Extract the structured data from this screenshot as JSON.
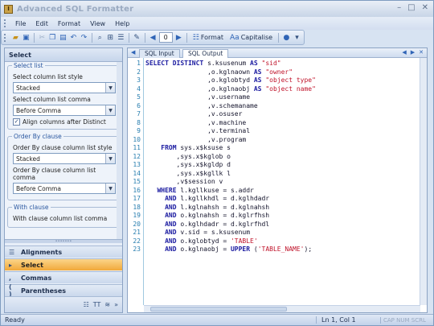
{
  "window": {
    "title": "Advanced SQL Formatter",
    "icon_letter": "I"
  },
  "menu": [
    "File",
    "Edit",
    "Format",
    "View",
    "Help"
  ],
  "toolbar": {
    "page_number": "0",
    "format_label": "Format",
    "capitalise_label": "Capitalise"
  },
  "left_panel": {
    "header": "Select",
    "select_list": {
      "title": "Select list",
      "style_label": "Select column list style",
      "style_value": "Stacked",
      "comma_label": "Select column list comma",
      "comma_value": "Before Comma",
      "align_label": "Align columns after Distinct"
    },
    "order_by": {
      "title": "Order By clause",
      "style_label": "Order By clause column list style",
      "style_value": "Stacked",
      "comma_label": "Order By clause column list comma",
      "comma_value": "Before Comma"
    },
    "with_clause": {
      "title": "With clause",
      "partial_label": "With clause column list comma"
    },
    "nav": [
      "Alignments",
      "Select",
      "Commas",
      "Parentheses"
    ]
  },
  "editor": {
    "tabs": [
      "SQL Input",
      "SQL Output"
    ],
    "active_tab": "SQL Output",
    "lines": [
      [
        [
          "kw",
          "SELECT DISTINCT"
        ],
        [
          "t",
          " s.ksusenum "
        ],
        [
          "kw",
          "AS"
        ],
        [
          "str",
          " \"sid\""
        ]
      ],
      [
        [
          "t",
          "                ,o.kglnaown "
        ],
        [
          "kw",
          "AS"
        ],
        [
          "str",
          " \"owner\""
        ]
      ],
      [
        [
          "t",
          "                ,o.kglobtyd "
        ],
        [
          "kw",
          "AS"
        ],
        [
          "str",
          " \"object type\""
        ]
      ],
      [
        [
          "t",
          "                ,o.kglnaobj "
        ],
        [
          "kw",
          "AS"
        ],
        [
          "str",
          " \"object name\""
        ]
      ],
      [
        [
          "t",
          "                ,v.username"
        ]
      ],
      [
        [
          "t",
          "                ,v.schemaname"
        ]
      ],
      [
        [
          "t",
          "                ,v.osuser"
        ]
      ],
      [
        [
          "t",
          "                ,v.machine"
        ]
      ],
      [
        [
          "t",
          "                ,v.terminal"
        ]
      ],
      [
        [
          "t",
          "                ,v.program"
        ]
      ],
      [
        [
          "kw",
          "    FROM"
        ],
        [
          "t",
          " sys.x$ksuse s"
        ]
      ],
      [
        [
          "t",
          "        ,sys.x$kglob o"
        ]
      ],
      [
        [
          "t",
          "        ,sys.x$kgldp d"
        ]
      ],
      [
        [
          "t",
          "        ,sys.x$kgllk l"
        ]
      ],
      [
        [
          "t",
          "        ,v$session v"
        ]
      ],
      [
        [
          "kw",
          "   WHERE"
        ],
        [
          "t",
          " l.kgllkuse = s.addr"
        ]
      ],
      [
        [
          "kw",
          "     AND"
        ],
        [
          "t",
          " l.kgllkhdl = d.kglhdadr"
        ]
      ],
      [
        [
          "kw",
          "     AND"
        ],
        [
          "t",
          " l.kglnahsh = d.kglnahsh"
        ]
      ],
      [
        [
          "kw",
          "     AND"
        ],
        [
          "t",
          " o.kglnahsh = d.kglrfhsh"
        ]
      ],
      [
        [
          "kw",
          "     AND"
        ],
        [
          "t",
          " o.kglhdadr = d.kglrfhdl"
        ]
      ],
      [
        [
          "kw",
          "     AND"
        ],
        [
          "t",
          " v.sid = s.ksusenum"
        ]
      ],
      [
        [
          "kw",
          "     AND"
        ],
        [
          "t",
          " o.kglobtyd = "
        ],
        [
          "str",
          "'TABLE'"
        ]
      ],
      [
        [
          "kw",
          "     AND"
        ],
        [
          "t",
          " o.kglnaobj = "
        ],
        [
          "kw",
          "UPPER"
        ],
        [
          "t",
          " ("
        ],
        [
          "str",
          "'TABLE_NAME'"
        ],
        [
          "t",
          ");"
        ]
      ]
    ]
  },
  "status": {
    "left": "Ready",
    "position": "Ln 1, Col 1",
    "keys": "CAP NUM SCRL"
  }
}
